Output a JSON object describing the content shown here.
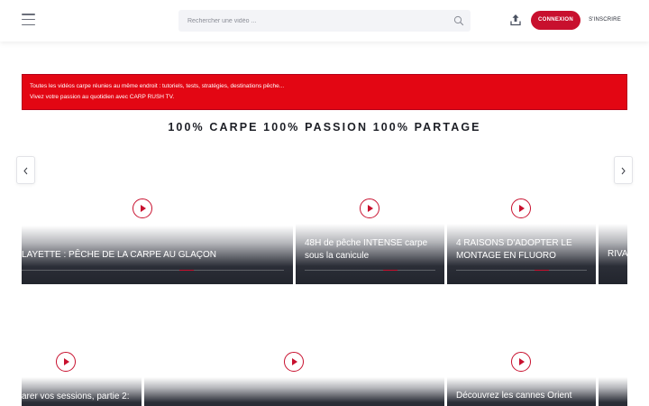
{
  "header": {
    "search_placeholder": "Rechercher une vidéo ...",
    "login_label": "CONNEXION",
    "signup_label": "S'INSCRIRE"
  },
  "banner": {
    "line1": "Toutes les vidéos carpe réunies au même endroit : tutoriels, tests, stratégies, destinations pêche...",
    "line2": "Vivez votre passion au quotidien avec CARP RUSH TV."
  },
  "headline": "100% CARPE 100% PASSION 100% PARTAGE",
  "row1": [
    "LAYETTE : PÊCHE DE LA CARPE AU GLAÇON",
    "48H de pêche INTENSE carpe sous la canicule",
    "4 RAISONS D'ADOPTER LE MONTAGE EN FLUORO",
    "RIVA"
  ],
  "row2": [
    "arer vos sessions, partie 2:",
    "Découvrez les cannes Orient"
  ],
  "colors": {
    "accent": "#c8102e",
    "banner_bg": "#e30613"
  }
}
